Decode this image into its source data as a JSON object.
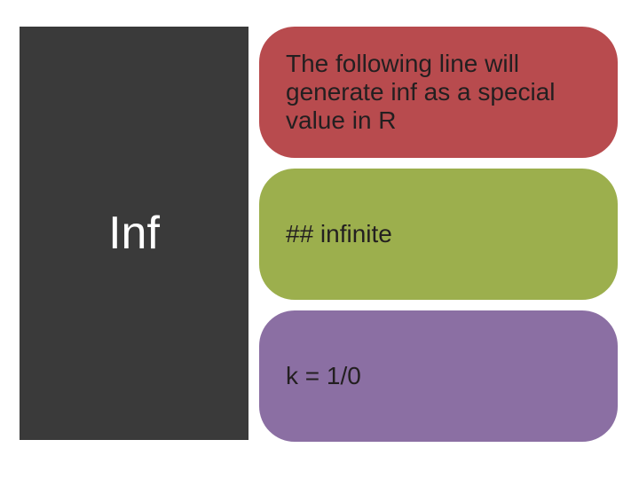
{
  "left": {
    "title": "Inf"
  },
  "pills": [
    {
      "text": "The following line will generate inf as a special value in R",
      "color": "#b84b4e"
    },
    {
      "text": "## infinite",
      "color": "#9caf4d"
    },
    {
      "text": "k = 1/0",
      "color": "#8b6fa3"
    }
  ]
}
